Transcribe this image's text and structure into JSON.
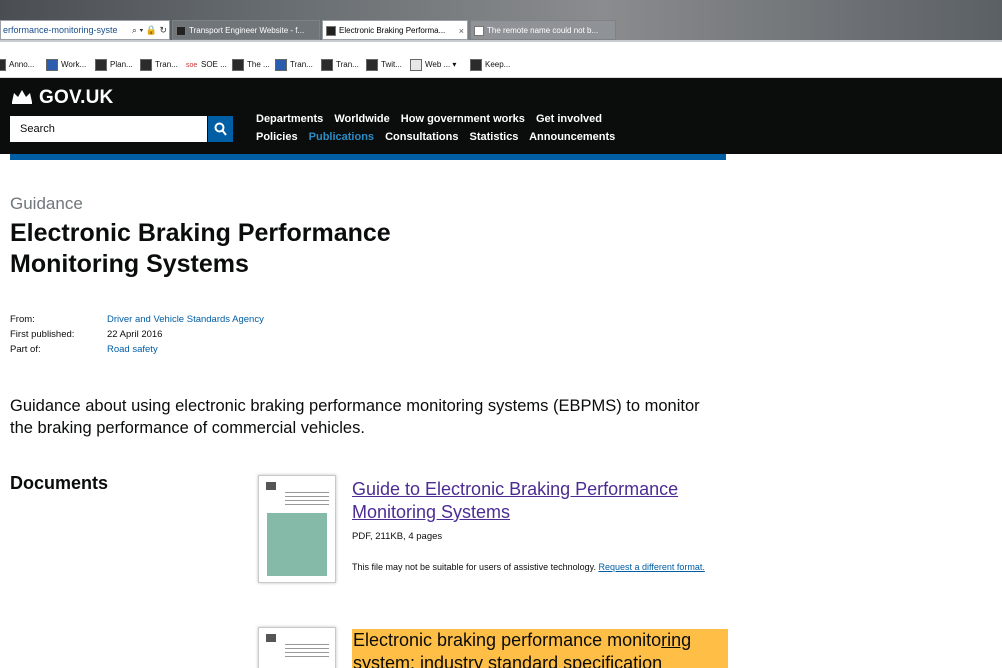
{
  "browser": {
    "address": "erformance-monitoring-syste",
    "tabs": [
      {
        "label": "Transport Engineer Website - f..."
      },
      {
        "label": "Electronic Braking Performa...",
        "close": "×"
      },
      {
        "label": "The remote name could not b..."
      }
    ],
    "bookmarks": [
      {
        "label": "Anno...",
        "icon": "doc-icon"
      },
      {
        "label": "Work...",
        "icon": "w-icon"
      },
      {
        "label": "Plan...",
        "icon": "doc-icon"
      },
      {
        "label": "Tran...",
        "icon": "doc-icon"
      },
      {
        "label": "SOE ...",
        "icon": "soe-icon"
      },
      {
        "label": "The ...",
        "icon": "doc-icon"
      },
      {
        "label": "Tran...",
        "icon": "bird-icon"
      },
      {
        "label": "Tran...",
        "icon": "doc-icon"
      },
      {
        "label": "Twit...",
        "icon": "doc-icon"
      },
      {
        "label": "Web ...",
        "icon": "web-icon"
      },
      {
        "label": "Keep...",
        "icon": "doc-icon"
      }
    ]
  },
  "header": {
    "logo": "GOV.UK",
    "search_placeholder": "Search",
    "nav_row1": [
      "Departments",
      "Worldwide",
      "How government works",
      "Get involved"
    ],
    "nav_row2": [
      "Policies",
      "Publications",
      "Consultations",
      "Statistics",
      "Announcements"
    ]
  },
  "page": {
    "kicker": "Guidance",
    "title": "Electronic Braking Performance Monitoring Systems",
    "meta": {
      "from_label": "From:",
      "from_value": "Driver and Vehicle Standards Agency",
      "published_label": "First published:",
      "published_value": "22 April 2016",
      "partof_label": "Part of:",
      "partof_value": "Road safety"
    },
    "lead": "Guidance about using electronic braking performance monitoring systems (EBPMS) to monitor the braking performance of commercial vehicles.",
    "documents_heading": "Documents",
    "documents": [
      {
        "title": "Guide to Electronic Braking Performance Monitoring Systems",
        "meta": "PDF, 211KB, 4 pages",
        "note": "This file may not be suitable for users of assistive technology.",
        "note_link": "Request a different format."
      },
      {
        "title_part1": "Electronic braking performance monito",
        "title_part2": "ring",
        "title_part3": " system: industry standard specification"
      }
    ]
  },
  "colors": {
    "header_bg": "#0b0c0c",
    "accent_blue": "#005ea5",
    "link_visited": "#4c2c92",
    "highlight": "#ffbf47",
    "thumb_panel": "#85b9a8"
  }
}
